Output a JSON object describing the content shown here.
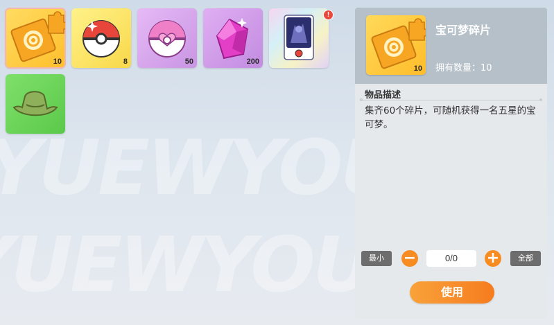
{
  "watermark": "YUEWYOU",
  "inventory": {
    "items": [
      {
        "icon": "puzzle-piece-icon",
        "count": "10",
        "bg": "#ffd04a"
      },
      {
        "icon": "poke-ball-icon",
        "count": "8",
        "bg": "#fde86a"
      },
      {
        "icon": "heart-ball-icon",
        "count": "50",
        "bg": "#d9a6ef"
      },
      {
        "icon": "pink-crystal-icon",
        "count": "200",
        "bg": "#cf9de8"
      },
      {
        "icon": "pokemon-card-icon",
        "count": "",
        "bg": "#e9eaf6"
      },
      {
        "icon": "green-hat-icon",
        "count": "",
        "bg": "#6fd25a"
      }
    ],
    "card_badge": "!"
  },
  "detail": {
    "name": "宝可梦碎片",
    "owned": "拥有数量：10",
    "icon_count": "10",
    "desc_title": "物品描述",
    "desc_text": "集齐60个碎片，可随机获得一名五星的宝可梦。",
    "min_label": "最小",
    "max_label": "全部",
    "qty_value": "0/0",
    "minus": "−",
    "plus": "+",
    "use_label": "使用"
  }
}
